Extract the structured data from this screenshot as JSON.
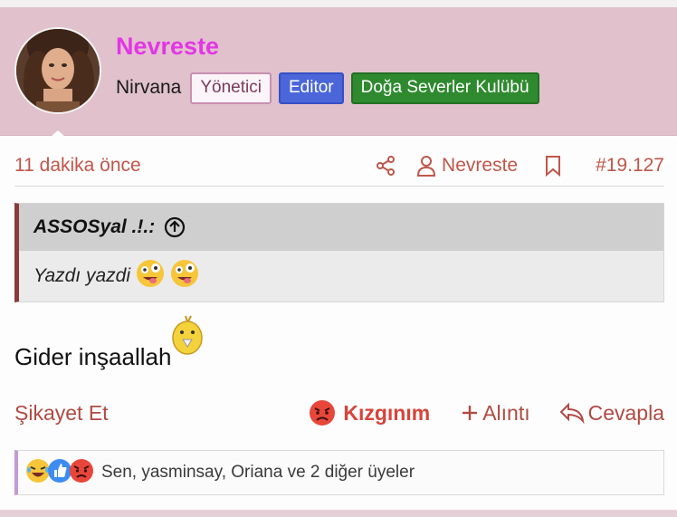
{
  "user": {
    "name": "Nevreste",
    "title": "Nirvana",
    "badges": [
      "Yönetici",
      "Editor",
      "Doğa Severler Kulübü"
    ]
  },
  "meta": {
    "time": "11 dakika önce",
    "author_link": "Nevreste",
    "post_number": "#19.127"
  },
  "quote": {
    "author": "ASSOSyal .!.:",
    "text": "Yazdı yazdi"
  },
  "message": {
    "text": "Gider inşaallah"
  },
  "actions": {
    "report": "Şikayet Et",
    "reaction": "Kızgınım",
    "quote": "Alıntı",
    "reply": "Cevapla"
  },
  "reactions": {
    "summary": "Sen, yasminsay, Oriana ve 2 diğer üyeler",
    "icons": [
      "laughing-face",
      "like-thumb",
      "angry-face"
    ]
  },
  "colors": {
    "username": "#e336e6",
    "header_bg": "#e0c1cc",
    "link": "#c0564a",
    "editor_badge": "#4a66d8",
    "club_badge": "#2f8a2f",
    "angry_reaction": "#d8433a"
  }
}
